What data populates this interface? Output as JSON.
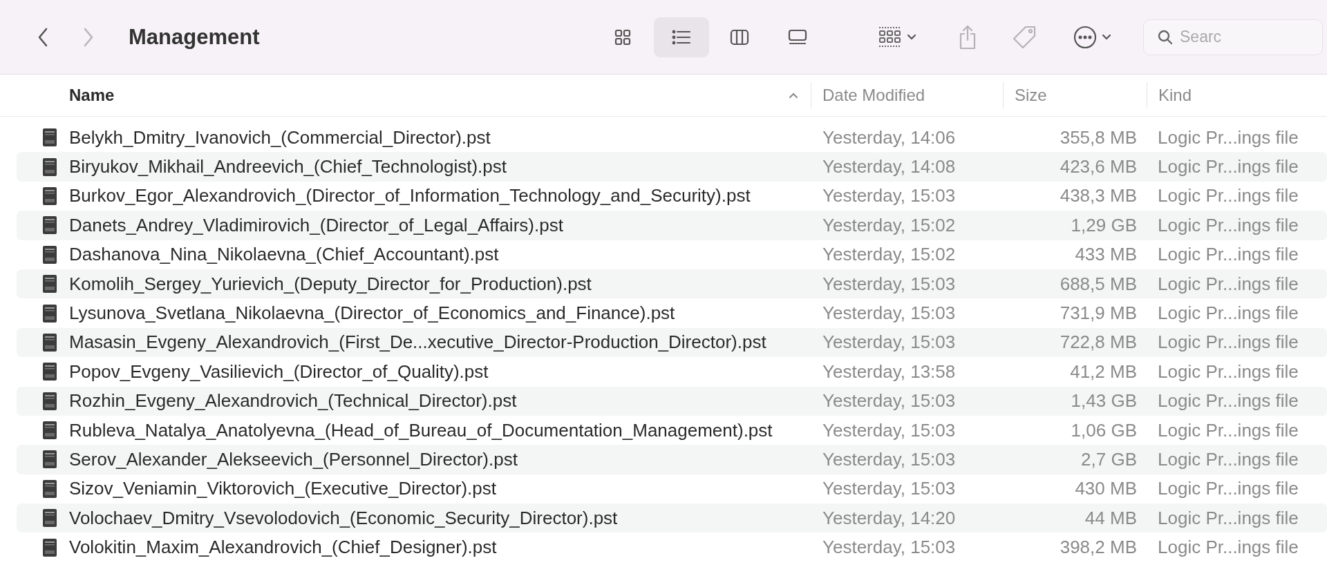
{
  "toolbar": {
    "back_button": {
      "disabled": false
    },
    "forward_button": {
      "disabled": true
    },
    "title": "Management",
    "view_modes": [
      {
        "kind": "icons",
        "selected": false
      },
      {
        "kind": "list",
        "selected": true
      },
      {
        "kind": "columns",
        "selected": false
      },
      {
        "kind": "gallery",
        "selected": false
      }
    ],
    "search": {
      "placeholder": "Searc"
    }
  },
  "table": {
    "columns": [
      {
        "label": "Name",
        "sorted": true
      },
      {
        "label": "Date Modified",
        "sorted": false
      },
      {
        "label": "Size",
        "sorted": false
      },
      {
        "label": "Kind",
        "sorted": false
      }
    ],
    "rows": [
      {
        "name": "Belykh_Dmitry_Ivanovich_(Commercial_Director).pst",
        "date_modified": "Yesterday, 14:06",
        "size": "355,8 MB",
        "kind": "Logic Pr...ings file"
      },
      {
        "name": "Biryukov_Mikhail_Andreevich_(Chief_Technologist).pst",
        "date_modified": "Yesterday, 14:08",
        "size": "423,6 MB",
        "kind": "Logic Pr...ings file"
      },
      {
        "name": "Burkov_Egor_Alexandrovich_(Director_of_Information_Technology_and_Security).pst",
        "date_modified": "Yesterday, 15:03",
        "size": "438,3 MB",
        "kind": "Logic Pr...ings file"
      },
      {
        "name": "Danets_Andrey_Vladimirovich_(Director_of_Legal_Affairs).pst",
        "date_modified": "Yesterday, 15:02",
        "size": "1,29 GB",
        "kind": "Logic Pr...ings file"
      },
      {
        "name": "Dashanova_Nina_Nikolaevna_(Chief_Accountant).pst",
        "date_modified": "Yesterday, 15:02",
        "size": "433 MB",
        "kind": "Logic Pr...ings file"
      },
      {
        "name": "Komolih_Sergey_Yurievich_(Deputy_Director_for_Production).pst",
        "date_modified": "Yesterday, 15:03",
        "size": "688,5 MB",
        "kind": "Logic Pr...ings file"
      },
      {
        "name": "Lysunova_Svetlana_Nikolaevna_(Director_of_Economics_and_Finance).pst",
        "date_modified": "Yesterday, 15:03",
        "size": "731,9 MB",
        "kind": "Logic Pr...ings file"
      },
      {
        "name": "Masasin_Evgeny_Alexandrovich_(First_De...xecutive_Director-Production_Director).pst",
        "date_modified": "Yesterday, 15:03",
        "size": "722,8 MB",
        "kind": "Logic Pr...ings file"
      },
      {
        "name": "Popov_Evgeny_Vasilievich_(Director_of_Quality).pst",
        "date_modified": "Yesterday, 13:58",
        "size": "41,2 MB",
        "kind": "Logic Pr...ings file"
      },
      {
        "name": "Rozhin_Evgeny_Alexandrovich_(Technical_Director).pst",
        "date_modified": "Yesterday, 15:03",
        "size": "1,43 GB",
        "kind": "Logic Pr...ings file"
      },
      {
        "name": "Rubleva_Natalya_Anatolyevna_(Head_of_Bureau_of_Documentation_Management).pst",
        "date_modified": "Yesterday, 15:03",
        "size": "1,06 GB",
        "kind": "Logic Pr...ings file"
      },
      {
        "name": "Serov_Alexander_Alekseevich_(Personnel_Director).pst",
        "date_modified": "Yesterday, 15:03",
        "size": "2,7 GB",
        "kind": "Logic Pr...ings file"
      },
      {
        "name": "Sizov_Veniamin_Viktorovich_(Executive_Director).pst",
        "date_modified": "Yesterday, 15:03",
        "size": "430 MB",
        "kind": "Logic Pr...ings file"
      },
      {
        "name": "Volochaev_Dmitry_Vsevolodovich_(Economic_Security_Director).pst",
        "date_modified": "Yesterday, 14:20",
        "size": "44 MB",
        "kind": "Logic Pr...ings file"
      },
      {
        "name": "Volokitin_Maxim_Alexandrovich_(Chief_Designer).pst",
        "date_modified": "Yesterday, 15:03",
        "size": "398,2 MB",
        "kind": "Logic Pr...ings file"
      }
    ]
  }
}
